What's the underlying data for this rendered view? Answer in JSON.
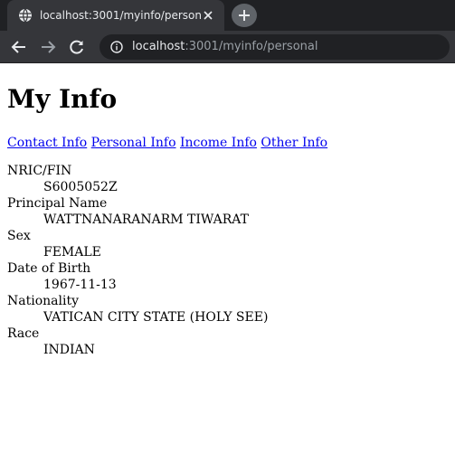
{
  "browser": {
    "tab_title": "localhost:3001/myinfo/personal",
    "url_host": "localhost",
    "url_path": ":3001/myinfo/personal",
    "icons": {
      "favicon": "globe-icon",
      "close": "close-icon",
      "new_tab": "plus-icon",
      "back": "back-arrow-icon",
      "forward": "forward-arrow-icon",
      "reload": "reload-icon",
      "site_info": "info-icon"
    },
    "colors": {
      "tabstrip": "#202124",
      "active_tab": "#35363a",
      "toolbar": "#35363a",
      "omnibox": "#202124"
    }
  },
  "page": {
    "title": "My Info",
    "nav": [
      {
        "label": "Contact Info"
      },
      {
        "label": "Personal Info"
      },
      {
        "label": "Income Info"
      },
      {
        "label": "Other Info"
      }
    ],
    "fields": [
      {
        "label": "NRIC/FIN",
        "value": "S6005052Z"
      },
      {
        "label": "Principal Name",
        "value": "WATTNANARANARM TIWARAT"
      },
      {
        "label": "Sex",
        "value": "FEMALE"
      },
      {
        "label": "Date of Birth",
        "value": "1967-11-13"
      },
      {
        "label": "Nationality",
        "value": "VATICAN CITY STATE (HOLY SEE)"
      },
      {
        "label": "Race",
        "value": "INDIAN"
      }
    ],
    "link_color": "#0000ee"
  }
}
